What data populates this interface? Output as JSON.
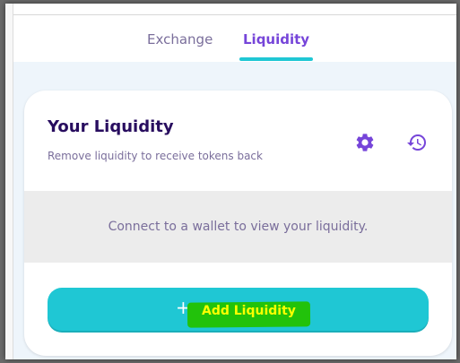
{
  "tabs": [
    {
      "label": "Exchange",
      "active": false
    },
    {
      "label": "Liquidity",
      "active": true
    }
  ],
  "card": {
    "title": "Your Liquidity",
    "subtitle": "Remove liquidity to receive tokens back",
    "empty_message": "Connect to a wallet to view your liquidity.",
    "settings_icon": "gear-icon",
    "history_icon": "history-icon",
    "add_button": {
      "plus": "+",
      "label": "Add Liquidity"
    }
  },
  "colors": {
    "primary": "#1fc7d4",
    "accent_purple": "#7645d9",
    "title_dark": "#280d5f",
    "text_secondary": "#7a6e9b",
    "highlight_green": "#22c20b",
    "highlight_text": "#ffff00"
  }
}
